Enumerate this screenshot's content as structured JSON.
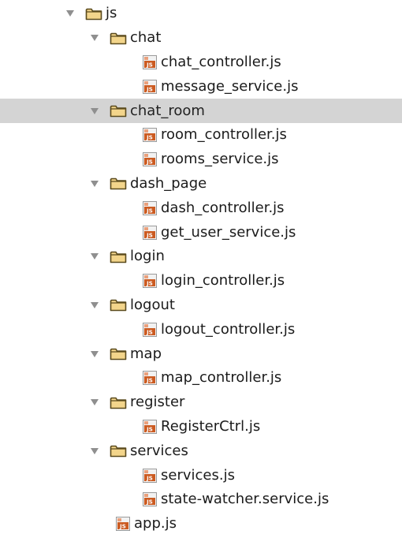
{
  "colors": {
    "folder_fill": "#f3d58b",
    "folder_stroke": "#5a4a1d",
    "js_icon_bg": "#f2f2f2",
    "js_icon_accent": "#cc5b21",
    "arrow": "#8f8f8f",
    "selection": "#d4d4d4"
  },
  "tree": [
    {
      "type": "folder",
      "depth": 0,
      "label": "js",
      "expanded": true,
      "selected": false
    },
    {
      "type": "folder",
      "depth": 1,
      "label": "chat",
      "expanded": true,
      "selected": false
    },
    {
      "type": "file",
      "depth": 2,
      "label": "chat_controller.js",
      "icon": "js-file-icon"
    },
    {
      "type": "file",
      "depth": 2,
      "label": "message_service.js",
      "icon": "js-file-icon"
    },
    {
      "type": "folder",
      "depth": 1,
      "label": "chat_room",
      "expanded": true,
      "selected": true
    },
    {
      "type": "file",
      "depth": 2,
      "label": "room_controller.js",
      "icon": "js-file-icon"
    },
    {
      "type": "file",
      "depth": 2,
      "label": "rooms_service.js",
      "icon": "js-file-icon"
    },
    {
      "type": "folder",
      "depth": 1,
      "label": "dash_page",
      "expanded": true,
      "selected": false
    },
    {
      "type": "file",
      "depth": 2,
      "label": "dash_controller.js",
      "icon": "js-file-icon"
    },
    {
      "type": "file",
      "depth": 2,
      "label": "get_user_service.js",
      "icon": "js-file-icon"
    },
    {
      "type": "folder",
      "depth": 1,
      "label": "login",
      "expanded": true,
      "selected": false
    },
    {
      "type": "file",
      "depth": 2,
      "label": "login_controller.js",
      "icon": "js-file-icon"
    },
    {
      "type": "folder",
      "depth": 1,
      "label": "logout",
      "expanded": true,
      "selected": false
    },
    {
      "type": "file",
      "depth": 2,
      "label": "logout_controller.js",
      "icon": "js-file-icon"
    },
    {
      "type": "folder",
      "depth": 1,
      "label": "map",
      "expanded": true,
      "selected": false
    },
    {
      "type": "file",
      "depth": 2,
      "label": "map_controller.js",
      "icon": "js-file-icon"
    },
    {
      "type": "folder",
      "depth": 1,
      "label": "register",
      "expanded": true,
      "selected": false
    },
    {
      "type": "file",
      "depth": 2,
      "label": "RegisterCtrl.js",
      "icon": "js-file-icon"
    },
    {
      "type": "folder",
      "depth": 1,
      "label": "services",
      "expanded": true,
      "selected": false
    },
    {
      "type": "file",
      "depth": 2,
      "label": "services.js",
      "icon": "js-file-icon"
    },
    {
      "type": "file",
      "depth": 2,
      "label": "state-watcher.service.js",
      "icon": "js-file-icon"
    },
    {
      "type": "file",
      "depth": 1,
      "label": "app.js",
      "icon": "js-file-icon"
    }
  ]
}
